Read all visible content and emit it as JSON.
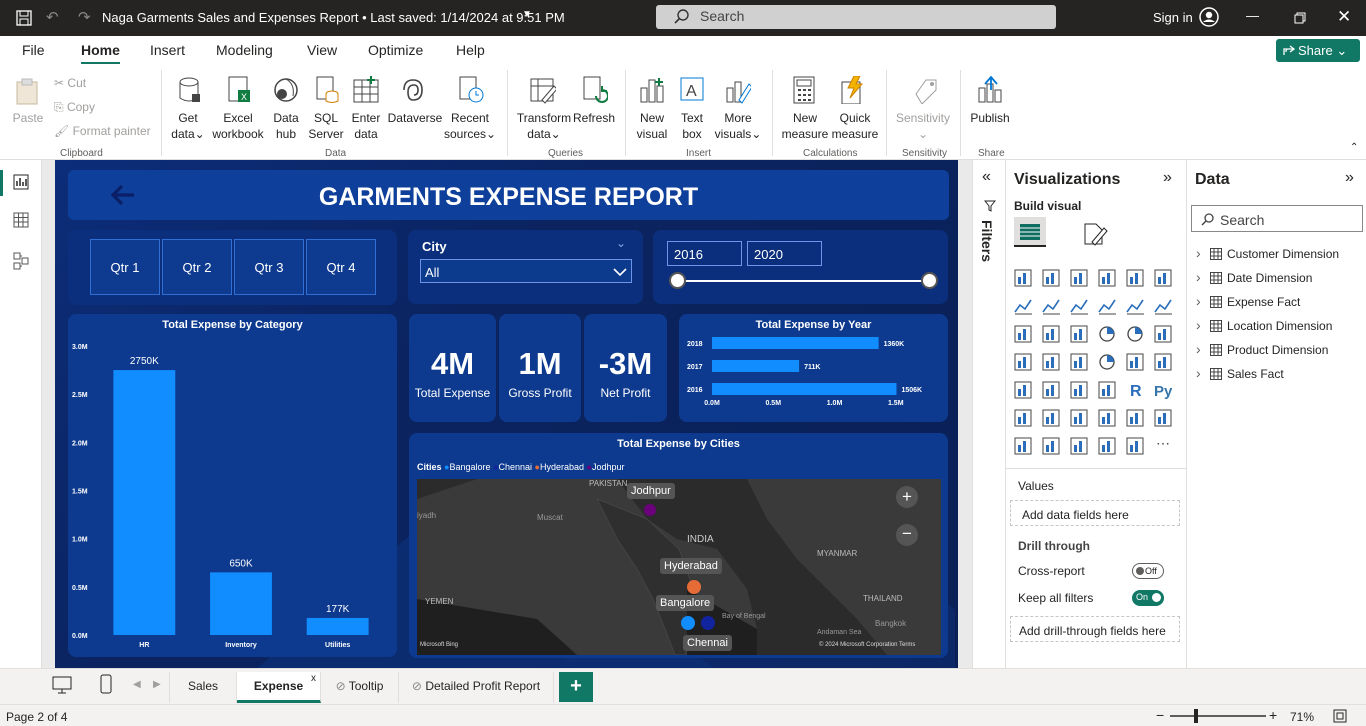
{
  "titlebar": {
    "title": "Naga Garments Sales and Expenses Report • Last saved: 1/14/2024 at 9:51 PM",
    "search_placeholder": "Search",
    "signin": "Sign in"
  },
  "menu": {
    "file": "File",
    "home": "Home",
    "insert": "Insert",
    "modeling": "Modeling",
    "view": "View",
    "optimize": "Optimize",
    "help": "Help",
    "share": "Share"
  },
  "ribbon": {
    "paste": "Paste",
    "cut": "Cut",
    "copy": "Copy",
    "format_painter": "Format painter",
    "get_data": "Get data",
    "excel": "Excel workbook",
    "data_hub": "Data hub",
    "sql": "SQL Server",
    "enter_data": "Enter data",
    "dataverse": "Dataverse",
    "recent": "Recent sources",
    "transform": "Transform data",
    "refresh": "Refresh",
    "new_visual": "New visual",
    "text_box": "Text box",
    "more_visuals": "More visuals",
    "new_measure": "New measure",
    "quick_measure": "Quick measure",
    "sensitivity": "Sensitivity",
    "publish": "Publish",
    "groups": {
      "clipboard": "Clipboard",
      "data": "Data",
      "queries": "Queries",
      "insert": "Insert",
      "calculations": "Calculations",
      "sensitivity": "Sensitivity",
      "share": "Share"
    }
  },
  "report": {
    "title": "GARMENTS EXPENSE REPORT",
    "quarters": [
      "Qtr 1",
      "Qtr 2",
      "Qtr 3",
      "Qtr 4"
    ],
    "city_label": "City",
    "city_value": "All",
    "year_from": "2016",
    "year_to": "2020",
    "kpis": [
      {
        "value": "4M",
        "label": "Total Expense"
      },
      {
        "value": "1M",
        "label": "Gross Profit"
      },
      {
        "value": "-3M",
        "label": "Net Profit"
      }
    ],
    "map": {
      "title": "Total Expense by Cities",
      "legend_title": "Cities",
      "legend": [
        "Bangalore",
        "Chennai",
        "Hyderabad",
        "Jodhpur"
      ],
      "labels": {
        "jodhpur": "Jodhpur",
        "hyderabad": "Hyderabad",
        "bangalore": "Bangalore",
        "chennai": "Chennai",
        "pakistan": "PAKISTAN",
        "india": "INDIA",
        "myanmar": "MYANMAR",
        "thailand": "THAILAND",
        "yemen": "YEMEN",
        "muscat": "Muscat",
        "riyadh": "iyadh",
        "bay": "Bay of Bengal",
        "bangkok": "Bangkok",
        "andaman": "Andaman Sea"
      },
      "bing": "Microsoft Bing",
      "copyright": "© 2024 Microsoft Corporation  Terms"
    }
  },
  "chart_data": [
    {
      "type": "bar",
      "title": "Total Expense by Category",
      "categories": [
        "HR",
        "Inventory",
        "Utilities"
      ],
      "values": [
        2750,
        650,
        177
      ],
      "data_labels": [
        "2750K",
        "650K",
        "177K"
      ],
      "ylim": [
        0,
        3000
      ],
      "yticks": [
        "0.0M",
        "0.5M",
        "1.0M",
        "1.5M",
        "2.0M",
        "2.5M",
        "3.0M"
      ],
      "color": "#118dff"
    },
    {
      "type": "bar",
      "orientation": "horizontal",
      "title": "Total Expense by Year",
      "categories": [
        "2018",
        "2017",
        "2016"
      ],
      "values": [
        1360,
        711,
        1506
      ],
      "data_labels": [
        "1360K",
        "711K",
        "1506K"
      ],
      "xlim": [
        0,
        1600
      ],
      "xticks": [
        "0.0M",
        "0.5M",
        "1.0M",
        "1.5M"
      ],
      "color": "#118dff"
    }
  ],
  "viz": {
    "title": "Visualizations",
    "build": "Build visual",
    "values": "Values",
    "add_fields": "Add data fields here",
    "drill": "Drill through",
    "cross_report": "Cross-report",
    "cross_state": "Off",
    "keep_filters": "Keep all filters",
    "keep_state": "On",
    "add_drill": "Add drill-through fields here"
  },
  "filters": {
    "label": "Filters"
  },
  "data_pane": {
    "title": "Data",
    "search": "Search",
    "tables": [
      "Customer Dimension",
      "Date Dimension",
      "Expense Fact",
      "Location Dimension",
      "Product Dimension",
      "Sales Fact"
    ]
  },
  "tabs": [
    "Sales",
    "Expense",
    "Tooltip",
    "Detailed Profit Report"
  ],
  "status": {
    "page": "Page 2 of 4",
    "zoom": "71%"
  }
}
